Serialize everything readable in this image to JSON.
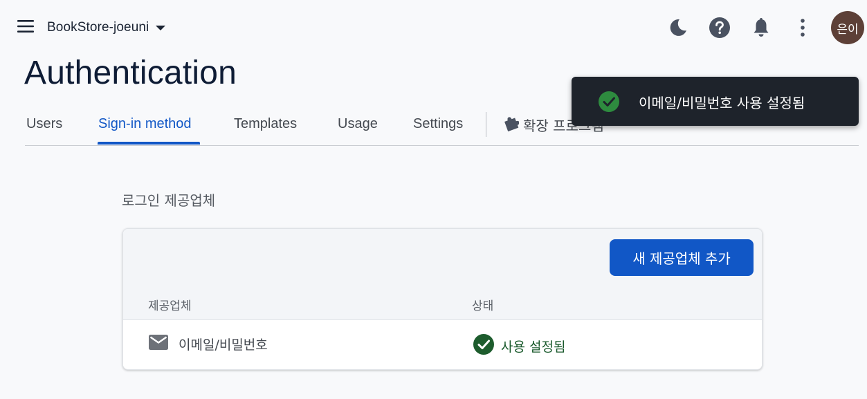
{
  "header": {
    "project_name": "BookStore-joeuni",
    "avatar_text": "은이"
  },
  "page": {
    "title": "Authentication"
  },
  "tabs": [
    {
      "label": "Users"
    },
    {
      "label": "Sign-in method",
      "active": true
    },
    {
      "label": "Templates"
    },
    {
      "label": "Usage"
    },
    {
      "label": "Settings"
    },
    {
      "label": "확장 프로그램",
      "icon": "puzzle-icon"
    }
  ],
  "providers_section": {
    "label": "로그인 제공업체",
    "add_button_label": "새 제공업체 추가",
    "columns": [
      "제공업체",
      "상태"
    ],
    "rows": [
      {
        "provider": "이메일/비밀번호",
        "icon": "mail-icon",
        "status": "사용 설정됨",
        "status_icon": "check-circle-icon"
      }
    ]
  },
  "toast": {
    "message": "이메일/비밀번호 사용 설정됨",
    "icon": "check-circle-icon"
  },
  "colors": {
    "accent": "#1157c6",
    "success": "#1a5a2c",
    "toast_bg": "#1e232b",
    "avatar_bg": "#5d4037"
  },
  "icons": {
    "menu": "menu-icon",
    "project_dropdown": "chevron-down-icon",
    "theme": "dark-mode-icon",
    "help": "help-icon",
    "notifications": "bell-icon",
    "more": "more-vert-icon"
  }
}
